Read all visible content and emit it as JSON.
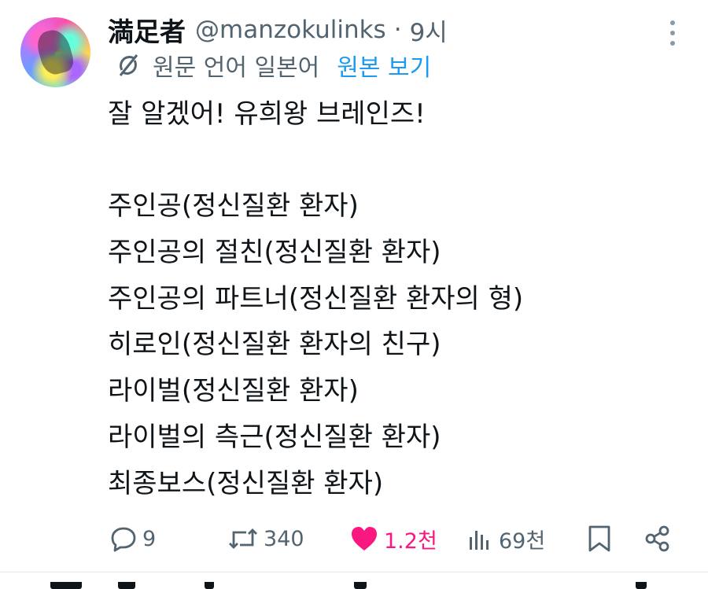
{
  "post": {
    "author_name": "満足者",
    "handle": "@manzokulinks",
    "separator": "·",
    "timestamp": "9시",
    "translation": {
      "label": "원문 언어 일본어",
      "link": "원본 보기"
    },
    "body_lines": [
      "잘 알겠어! 유희왕 브레인즈!",
      "",
      "주인공(정신질환 환자)",
      "주인공의 절친(정신질환 환자)",
      "주인공의 파트너(정신질환 환자의 형)",
      "히로인(정신질환 환자의 친구)",
      "라이벌(정신질환 환자)",
      "라이벌의 측근(정신질환 환자)",
      "최종보스(정신질환 환자)"
    ]
  },
  "actions": {
    "replies": "9",
    "reposts": "340",
    "likes": "1.2천",
    "views": "69천"
  },
  "colors": {
    "text": "#0f1419",
    "secondary": "#536471",
    "link": "#1d9bf0",
    "like": "#f91880"
  },
  "icons": [
    "more-options-icon",
    "translate-icon",
    "reply-icon",
    "repost-icon",
    "like-icon",
    "views-icon",
    "bookmark-icon",
    "share-icon"
  ]
}
